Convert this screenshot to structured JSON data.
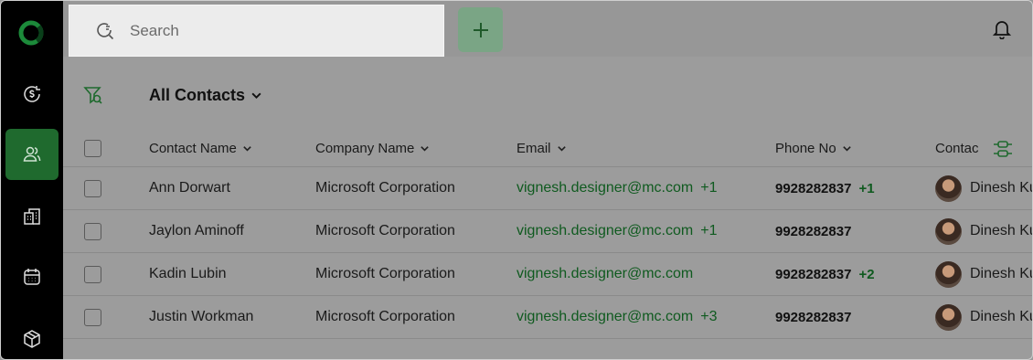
{
  "search": {
    "placeholder": "Search"
  },
  "filter": {
    "view_label": "All Contacts"
  },
  "table": {
    "columns": [
      "Contact Name",
      "Company Name",
      "Email",
      "Phone No",
      "Contac"
    ],
    "rows": [
      {
        "name": "Ann Dorwart",
        "company": "Microsoft Corporation",
        "email": "vignesh.designer@mc.com",
        "email_extra": "+1",
        "phone": "9928282837",
        "phone_extra": "+1",
        "owner": "Dinesh Ku"
      },
      {
        "name": "Jaylon Aminoff",
        "company": "Microsoft Corporation",
        "email": "vignesh.designer@mc.com",
        "email_extra": "+1",
        "phone": "9928282837",
        "phone_extra": "",
        "owner": "Dinesh Ku"
      },
      {
        "name": "Kadin Lubin",
        "company": "Microsoft Corporation",
        "email": "vignesh.designer@mc.com",
        "email_extra": "",
        "phone": "9928282837",
        "phone_extra": "+2",
        "owner": "Dinesh Ku"
      },
      {
        "name": "Justin Workman",
        "company": "Microsoft Corporation",
        "email": "vignesh.designer@mc.com",
        "email_extra": "+3",
        "phone": "9928282837",
        "phone_extra": "",
        "owner": "Dinesh Ku"
      }
    ]
  },
  "sidebar": {
    "items": [
      {
        "icon": "money-cycle-icon"
      },
      {
        "icon": "contacts-icon",
        "active": true
      },
      {
        "icon": "building-icon"
      },
      {
        "icon": "calendar-icon"
      },
      {
        "icon": "box-icon"
      }
    ]
  },
  "colors": {
    "accent": "#1f6a2e",
    "link": "#0f5a1f",
    "sidebar_bg": "#000000"
  }
}
